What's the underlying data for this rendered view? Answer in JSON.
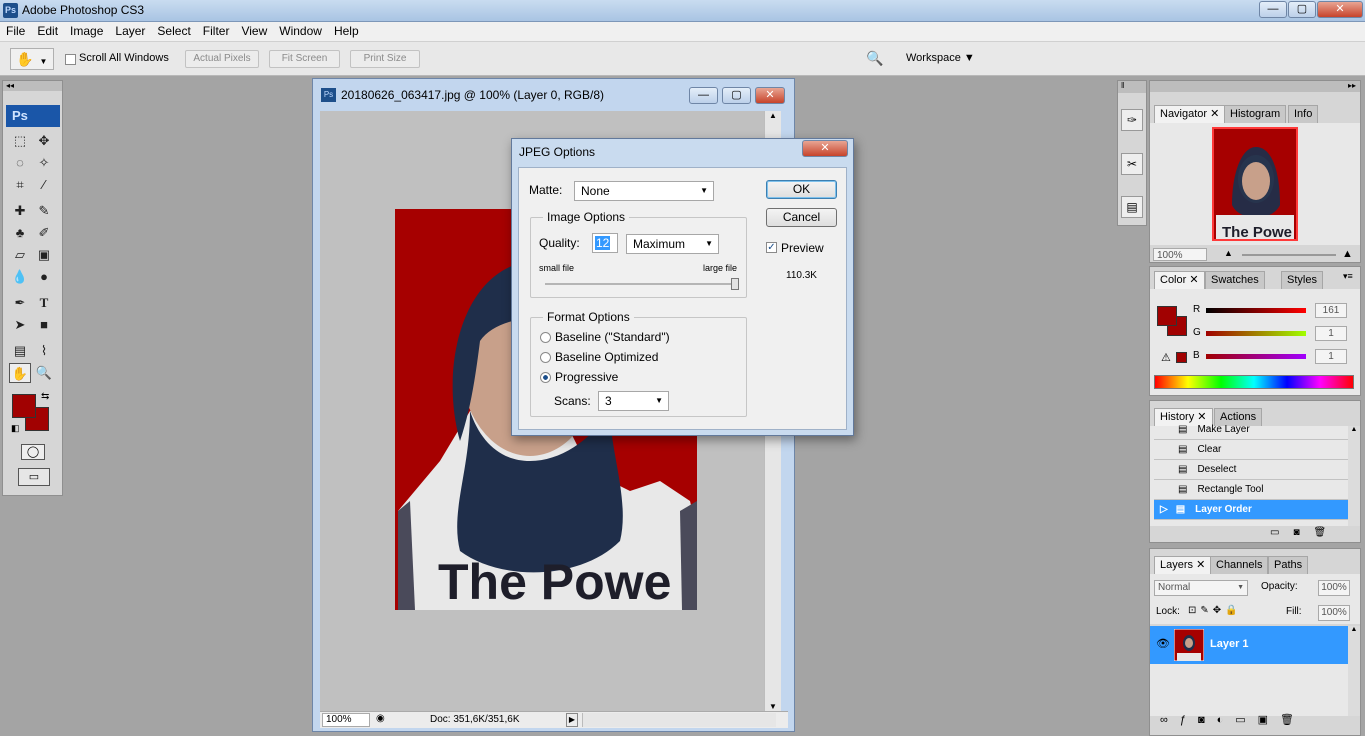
{
  "window": {
    "title": "Adobe Photoshop CS3",
    "app_icon": "Ps",
    "minimize": "—",
    "restore": "▢",
    "close": "✕"
  },
  "menu": [
    "File",
    "Edit",
    "Image",
    "Layer",
    "Select",
    "Filter",
    "View",
    "Window",
    "Help"
  ],
  "options": {
    "scroll_all": "Scroll All Windows",
    "actual_pixels": "Actual Pixels",
    "fit_screen": "Fit Screen",
    "print_size": "Print Size",
    "workspace": "Workspace ▼"
  },
  "toolbox": {
    "logo": "Ps",
    "fg_color": "#a10101",
    "bg_color": "#a10101"
  },
  "document": {
    "title": "20180626_063417.jpg @ 100% (Layer 0, RGB/8)",
    "zoom": "100%",
    "doc_info": "Doc: 351,6K/351,6K",
    "shirt_text": "The Powe"
  },
  "dialog": {
    "title": "JPEG Options",
    "matte_label": "Matte:",
    "matte_value": "None",
    "image_options": "Image Options",
    "quality_label": "Quality:",
    "quality_value": "12",
    "quality_preset": "Maximum",
    "small_file": "small file",
    "large_file": "large file",
    "quality_fraction": 1.0,
    "format_options": "Format Options",
    "baseline_standard": "Baseline (\"Standard\")",
    "baseline_optimized": "Baseline Optimized",
    "progressive": "Progressive",
    "scans_label": "Scans:",
    "scans_value": "3",
    "ok": "OK",
    "cancel": "Cancel",
    "preview": "Preview",
    "file_size": "110.3K"
  },
  "navigator": {
    "tabs": [
      "Navigator",
      "Histogram",
      "Info"
    ],
    "zoom": "100%"
  },
  "color": {
    "tabs": [
      "Color",
      "Swatches",
      "Styles"
    ],
    "r_label": "R",
    "r_value": "161",
    "g_label": "G",
    "g_value": "1",
    "b_label": "B",
    "b_value": "1"
  },
  "history": {
    "tabs": [
      "History",
      "Actions"
    ],
    "items": [
      "Make Layer",
      "Clear",
      "Deselect",
      "Rectangle Tool",
      "Layer Order"
    ]
  },
  "layers": {
    "tabs": [
      "Layers",
      "Channels",
      "Paths"
    ],
    "blend_mode": "Normal",
    "opacity_label": "Opacity:",
    "opacity_value": "100%",
    "lock_label": "Lock:",
    "fill_label": "Fill:",
    "fill_value": "100%",
    "layer_name": "Layer 1"
  },
  "colors": {
    "accent": "#3399ff",
    "photo_red": "#a60000",
    "scarf": "#1f2e4a"
  }
}
